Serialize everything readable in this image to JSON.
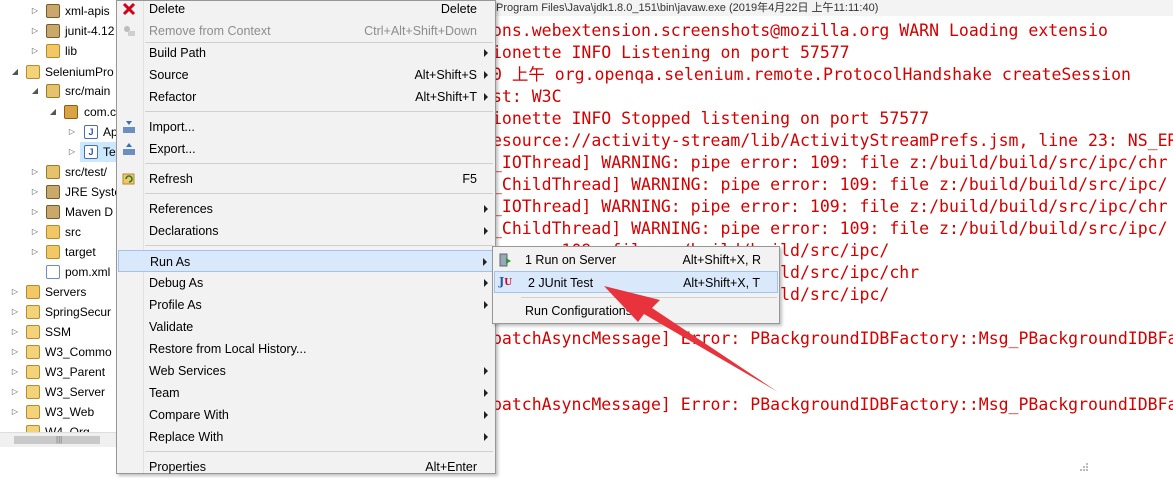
{
  "tree": {
    "items": [
      {
        "label": "xml-apis",
        "icon": "jar-icon"
      },
      {
        "label": "junit-4.12",
        "icon": "jar-icon"
      },
      {
        "label": "lib",
        "icon": "folder-icon"
      },
      {
        "label": "SeleniumPro",
        "icon": "project-icon"
      },
      {
        "label": "src/main",
        "icon": "source-folder-icon"
      },
      {
        "label": "com.c",
        "icon": "package-icon"
      },
      {
        "label": "Ap",
        "icon": "java-file-icon"
      },
      {
        "label": "Te",
        "icon": "java-file-icon"
      },
      {
        "label": "src/test/",
        "icon": "source-folder-icon"
      },
      {
        "label": "JRE Syste",
        "icon": "library-icon"
      },
      {
        "label": "Maven D",
        "icon": "library-icon"
      },
      {
        "label": "src",
        "icon": "folder-icon"
      },
      {
        "label": "target",
        "icon": "folder-icon"
      },
      {
        "label": "pom.xml",
        "icon": "xml-file-icon"
      },
      {
        "label": "Servers",
        "icon": "folder-icon"
      },
      {
        "label": "SpringSecur",
        "icon": "project-icon"
      },
      {
        "label": "SSM",
        "icon": "project-icon"
      },
      {
        "label": "W3_Commo",
        "icon": "project-icon"
      },
      {
        "label": "W3_Parent",
        "icon": "project-icon"
      },
      {
        "label": "W3_Server",
        "icon": "project-icon"
      },
      {
        "label": "W3_Web",
        "icon": "project-icon"
      },
      {
        "label": "W4_Org",
        "icon": "project-icon"
      }
    ]
  },
  "console": {
    "header": "Program Files\\Java\\jdk1.8.0_151\\bin\\javaw.exe (2019年4月22日 上午11:11:40)",
    "lines": [
      "ons.webextension.screenshots@mozilla.org      WARN    Loading extensio",
      "ionette      INFO    Listening on port 57577",
      "0 上午 org.openqa.selenium.remote.ProtocolHandshake createSession",
      "st: W3C",
      "ionette      INFO    Stopped listening on port 57577",
      "esource://activity-stream/lib/ActivityStreamPrefs.jsm, line 23: NS_ER",
      "_IOThread] WARNING: pipe error: 109: file z:/build/build/src/ipc/chr",
      "_ChildThread] WARNING: pipe error: 109: file z:/build/build/src/ipc/",
      "_IOThread] WARNING: pipe error: 109: file z:/build/build/src/ipc/chr",
      "_ChildThread] WARNING: pipe error: 109: file z:/build/build/src/ipc/",
      "                     error: 109: file z:/build/build/src/ipc/",
      "                     error: 109: file z:/build/build/src/ipc/chr",
      "                     error: 109: file z:/build/build/src/ipc/",
      "",
      "patchAsyncMessage] Error: PBackgroundIDBFactory::Msg_PBackgroundIDBFa",
      "",
      "",
      "patchAsyncMessage] Error: PBackgroundIDBFactory::Msg_PBackgroundIDBFa"
    ]
  },
  "context_menu": {
    "items": [
      {
        "label": "Delete",
        "shortcut": "Delete",
        "icon": "delete-icon"
      },
      {
        "label": "Remove from Context",
        "shortcut": "Ctrl+Alt+Shift+Down",
        "icon": "remove-context-icon",
        "disabled": true
      },
      {
        "label": "Build Path",
        "submenu": true
      },
      {
        "label": "Source",
        "shortcut": "Alt+Shift+S",
        "submenu": true
      },
      {
        "label": "Refactor",
        "shortcut": "Alt+Shift+T",
        "submenu": true
      },
      {
        "label": "Import...",
        "icon": "import-icon"
      },
      {
        "label": "Export...",
        "icon": "export-icon"
      },
      {
        "label": "Refresh",
        "shortcut": "F5",
        "icon": "refresh-icon"
      },
      {
        "label": "References",
        "submenu": true
      },
      {
        "label": "Declarations",
        "submenu": true
      },
      {
        "label": "Run As",
        "submenu": true,
        "highlighted": true
      },
      {
        "label": "Debug As",
        "submenu": true
      },
      {
        "label": "Profile As",
        "submenu": true
      },
      {
        "label": "Validate"
      },
      {
        "label": "Restore from Local History..."
      },
      {
        "label": "Web Services",
        "submenu": true
      },
      {
        "label": "Team",
        "submenu": true
      },
      {
        "label": "Compare With",
        "submenu": true
      },
      {
        "label": "Replace With",
        "submenu": true
      },
      {
        "label": "Properties",
        "shortcut": "Alt+Enter"
      }
    ]
  },
  "run_as_submenu": {
    "items": [
      {
        "label": "1 Run on Server",
        "shortcut": "Alt+Shift+X, R",
        "icon": "server-run-icon"
      },
      {
        "label": "2 JUnit Test",
        "shortcut": "Alt+Shift+X, T",
        "icon": "junit-icon",
        "highlighted": true
      },
      {
        "label": "Run Configurations..."
      }
    ]
  },
  "colors": {
    "console_text": "#d40000",
    "menu_highlight": "#d9e8fb",
    "annotation_arrow": "#e8323c"
  }
}
